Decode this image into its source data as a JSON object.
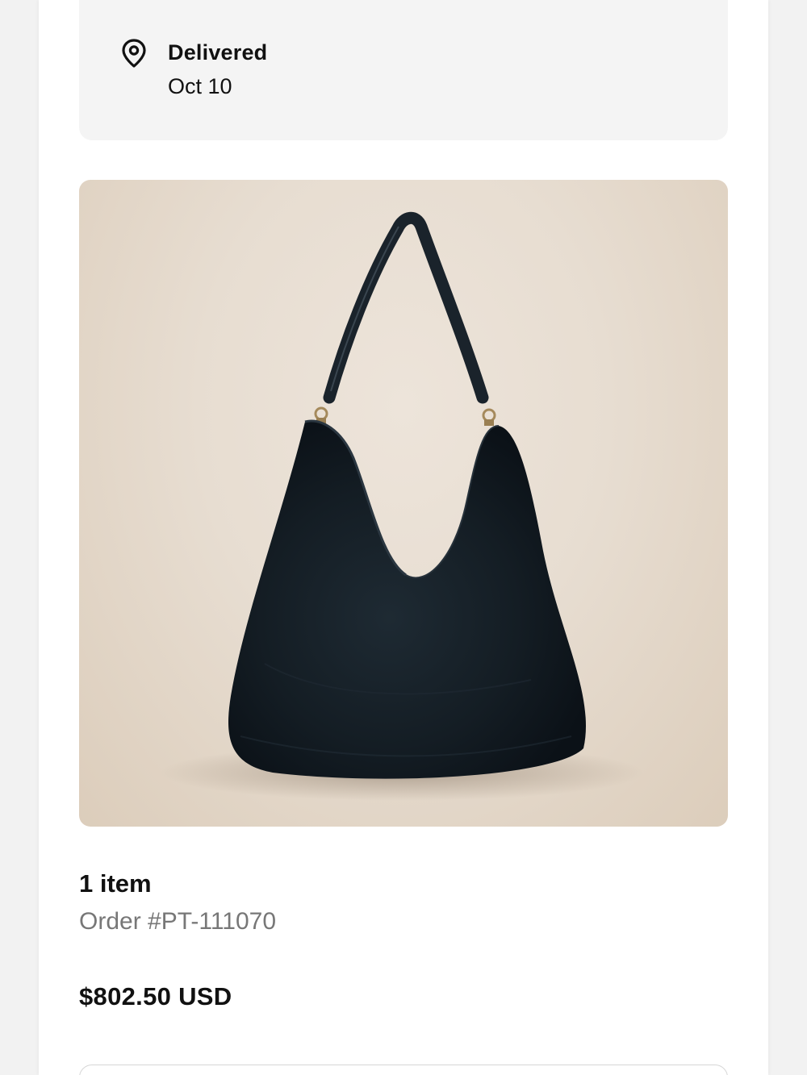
{
  "delivery": {
    "status": "Delivered",
    "date": "Oct 10",
    "icon": "location-pin-icon"
  },
  "product": {
    "image_description": "black suede hobo shoulder bag"
  },
  "order": {
    "items_count": "1 item",
    "order_number": "Order #PT-111070",
    "total": "$802.50 USD"
  },
  "colors": {
    "card_background": "#f4f4f4",
    "muted_text": "#777777",
    "text": "#111111"
  }
}
